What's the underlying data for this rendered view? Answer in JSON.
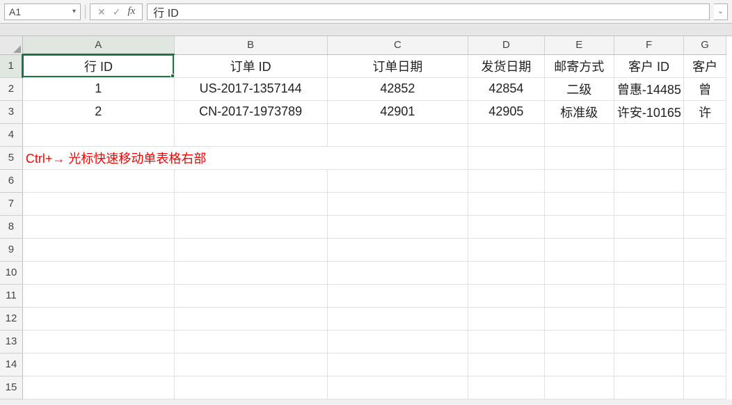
{
  "nameBox": {
    "value": "A1"
  },
  "fx": {
    "cancel": "✕",
    "enter": "✓",
    "label": "fx"
  },
  "formulaBar": {
    "value": "行 ID"
  },
  "columns": [
    "A",
    "B",
    "C",
    "D",
    "E",
    "F",
    "G"
  ],
  "rowCount": 15,
  "colWidths": {
    "rowHead": 32,
    "A": 215,
    "B": 217,
    "C": 200,
    "D": 108,
    "E": 99,
    "F": 99,
    "G": 60
  },
  "headers": {
    "A": "行 ID",
    "B": "订单 ID",
    "C": "订单日期",
    "D": "发货日期",
    "E": "邮寄方式",
    "F": "客户 ID",
    "G": "客户"
  },
  "rows": [
    {
      "A": "1",
      "B": "US-2017-1357144",
      "C": "42852",
      "D": "42854",
      "E": "二级",
      "F": "曾惠-14485",
      "G": "曾"
    },
    {
      "A": "2",
      "B": "CN-2017-1973789",
      "C": "42901",
      "D": "42905",
      "E": "标准级",
      "F": "许安-10165",
      "G": "许"
    }
  ],
  "note": {
    "row": 5,
    "text": "Ctrl+→  光标快速移动单表格右部"
  },
  "activeCell": {
    "row": 1,
    "col": "A"
  }
}
